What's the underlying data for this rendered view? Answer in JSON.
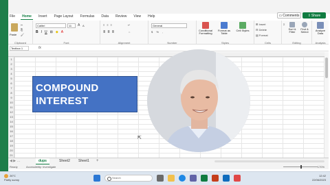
{
  "ribbon_tabs": [
    "File",
    "Home",
    "Insert",
    "Page Layout",
    "Formulas",
    "Data",
    "Review",
    "View",
    "Help"
  ],
  "active_tab": "Home",
  "header_buttons": {
    "comments": "Comments",
    "share": "Share"
  },
  "ribbon": {
    "clipboard": {
      "label": "Clipboard",
      "paste": "Paste"
    },
    "font": {
      "label": "Font",
      "font_name": "Calibri",
      "font_size": "11"
    },
    "alignment": {
      "label": "Alignment"
    },
    "number": {
      "label": "Number",
      "format": "General"
    },
    "styles": {
      "label": "Styles",
      "conditional": "Conditional Formatting",
      "format_table": "Format as Table",
      "cell_styles": "Cell Styles"
    },
    "cells": {
      "label": "Cells",
      "insert": "Insert",
      "delete": "Delete",
      "format": "Format"
    },
    "editing": {
      "label": "Editing",
      "sort_filter": "Sort & Filter",
      "find_select": "Find & Select"
    },
    "analysis": {
      "label": "Analysis",
      "analyze": "Analyze Data"
    }
  },
  "formula_bar": {
    "name_box": "Textbox 1",
    "fx": "fx"
  },
  "title_box": {
    "line1": "COMPOUND",
    "line2": "INTEREST"
  },
  "row_numbers": [
    "1",
    "2",
    "3",
    "4",
    "5",
    "6",
    "7",
    "8",
    "9",
    "10",
    "11",
    "12",
    "13",
    "14",
    "15",
    "16",
    "17",
    "18",
    "19",
    "20",
    "21"
  ],
  "sheets": [
    {
      "name": "dups",
      "active": true
    },
    {
      "name": "Sheet2",
      "active": false
    },
    {
      "name": "Sheet1",
      "active": false
    }
  ],
  "sheet_add": "+",
  "status": {
    "ready": "Ready",
    "accessibility": "Accessibility: Investigate",
    "zoom": "170%"
  },
  "taskbar": {
    "weather_temp": "26°C",
    "weather_desc": "Partly sunny",
    "search_placeholder": "Search",
    "time": "12:42",
    "date": "22/06/2023"
  },
  "colors": {
    "excel_green": "#107c41",
    "title_fill": "#4472c4"
  }
}
